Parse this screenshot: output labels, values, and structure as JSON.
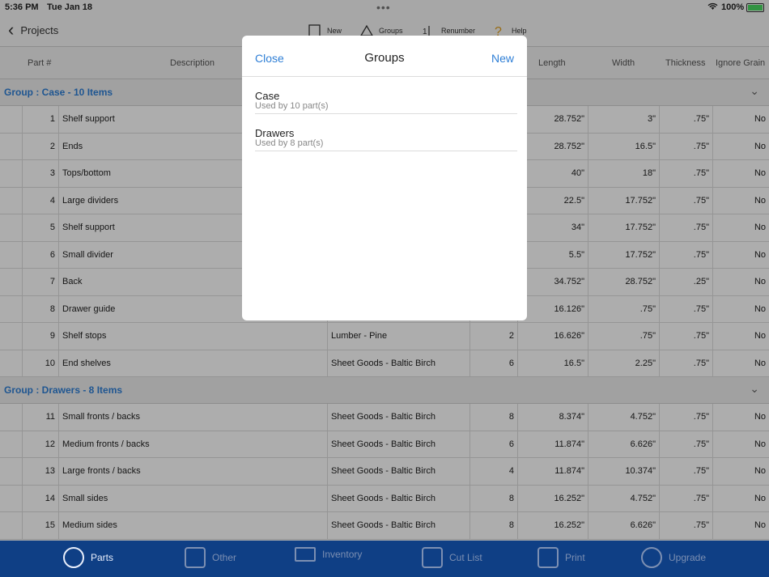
{
  "status": {
    "time": "5:36 PM",
    "date": "Tue Jan 18",
    "battery": "100%"
  },
  "nav": {
    "back_label": "Projects",
    "toolbar": [
      {
        "label": "New",
        "icon": "new-doc-icon"
      },
      {
        "label": "Groups",
        "icon": "groups-icon"
      },
      {
        "label": "Renumber",
        "icon": "renumber-icon"
      },
      {
        "label": "Help",
        "icon": "help-icon"
      }
    ]
  },
  "table": {
    "headers": [
      "Part #",
      "Description",
      "",
      "",
      "Length",
      "Width",
      "Thickness",
      "Ignore Grain"
    ],
    "groups": [
      {
        "title": "Group : Case - 10 Items",
        "rows": [
          {
            "num": "1",
            "desc": "Shelf support",
            "material": "",
            "qty": "",
            "length": "28.752\"",
            "width": "3\"",
            "thickness": ".75\"",
            "grain": "No"
          },
          {
            "num": "2",
            "desc": "Ends",
            "material": "",
            "qty": "",
            "length": "28.752\"",
            "width": "16.5\"",
            "thickness": ".75\"",
            "grain": "No"
          },
          {
            "num": "3",
            "desc": "Tops/bottom",
            "material": "",
            "qty": "",
            "length": "40\"",
            "width": "18\"",
            "thickness": ".75\"",
            "grain": "No"
          },
          {
            "num": "4",
            "desc": "Large dividers",
            "material": "",
            "qty": "",
            "length": "22.5\"",
            "width": "17.752\"",
            "thickness": ".75\"",
            "grain": "No"
          },
          {
            "num": "5",
            "desc": "Shelf support",
            "material": "",
            "qty": "",
            "length": "34\"",
            "width": "17.752\"",
            "thickness": ".75\"",
            "grain": "No"
          },
          {
            "num": "6",
            "desc": "Small divider",
            "material": "",
            "qty": "",
            "length": "5.5\"",
            "width": "17.752\"",
            "thickness": ".75\"",
            "grain": "No"
          },
          {
            "num": "7",
            "desc": "Back",
            "material": "",
            "qty": "",
            "length": "34.752\"",
            "width": "28.752\"",
            "thickness": ".25\"",
            "grain": "No"
          },
          {
            "num": "8",
            "desc": "Drawer guide",
            "material": "",
            "qty": "",
            "length": "16.126\"",
            "width": ".75\"",
            "thickness": ".75\"",
            "grain": "No"
          },
          {
            "num": "9",
            "desc": "Shelf stops",
            "material": "Lumber - Pine",
            "qty": "2",
            "length": "16.626\"",
            "width": ".75\"",
            "thickness": ".75\"",
            "grain": "No"
          },
          {
            "num": "10",
            "desc": "End shelves",
            "material": "Sheet Goods - Baltic Birch",
            "qty": "6",
            "length": "16.5\"",
            "width": "2.25\"",
            "thickness": ".75\"",
            "grain": "No"
          }
        ]
      },
      {
        "title": "Group : Drawers - 8 Items",
        "rows": [
          {
            "num": "11",
            "desc": "Small fronts / backs",
            "material": "Sheet Goods - Baltic Birch",
            "qty": "8",
            "length": "8.374\"",
            "width": "4.752\"",
            "thickness": ".75\"",
            "grain": "No"
          },
          {
            "num": "12",
            "desc": "Medium fronts / backs",
            "material": "Sheet Goods - Baltic Birch",
            "qty": "6",
            "length": "11.874\"",
            "width": "6.626\"",
            "thickness": ".75\"",
            "grain": "No"
          },
          {
            "num": "13",
            "desc": "Large fronts / backs",
            "material": "Sheet Goods - Baltic Birch",
            "qty": "4",
            "length": "11.874\"",
            "width": "10.374\"",
            "thickness": ".75\"",
            "grain": "No"
          },
          {
            "num": "14",
            "desc": "Small sides",
            "material": "Sheet Goods - Baltic Birch",
            "qty": "8",
            "length": "16.252\"",
            "width": "4.752\"",
            "thickness": ".75\"",
            "grain": "No"
          },
          {
            "num": "15",
            "desc": "Medium sides",
            "material": "Sheet Goods - Baltic Birch",
            "qty": "8",
            "length": "16.252\"",
            "width": "6.626\"",
            "thickness": ".75\"",
            "grain": "No"
          }
        ]
      }
    ]
  },
  "modal": {
    "close_label": "Close",
    "title": "Groups",
    "new_label": "New",
    "items": [
      {
        "name": "Case",
        "usage": "Used by 10 part(s)"
      },
      {
        "name": "Drawers",
        "usage": "Used by 8 part(s)"
      }
    ]
  },
  "tabbar": {
    "tabs": [
      {
        "label": "Parts",
        "icon": "tape-measure-icon",
        "active": true
      },
      {
        "label": "Other",
        "icon": "checklist-icon",
        "active": false
      },
      {
        "label": "Inventory",
        "icon": "lumber-stack-icon",
        "active": false
      },
      {
        "label": "Cut List",
        "icon": "cut-layout-icon",
        "active": false
      },
      {
        "label": "Print",
        "icon": "print-doc-icon",
        "active": false
      },
      {
        "label": "Upgrade",
        "icon": "upgrade-arrow-icon",
        "active": false
      }
    ]
  },
  "colors": {
    "accent": "#2f7fd6",
    "tabbar": "#0f3f85"
  }
}
